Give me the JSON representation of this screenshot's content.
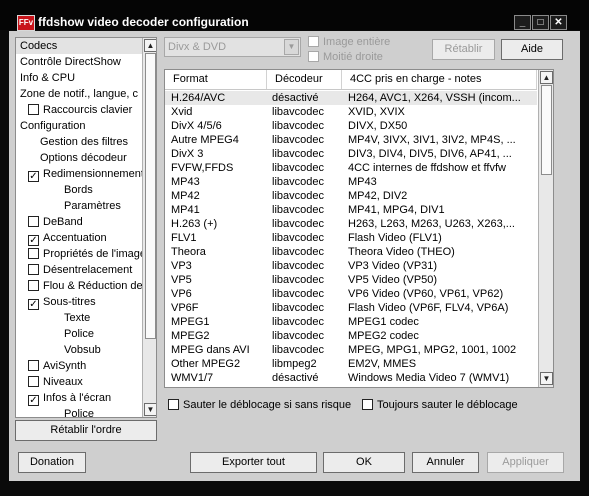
{
  "window": {
    "icon_text": "FFv",
    "title": "ffdshow video decoder configuration",
    "controls": {
      "minimize": "_",
      "maximize": "□",
      "close": "✕"
    }
  },
  "tree": {
    "items": [
      {
        "label": "Codecs",
        "indent": 0,
        "checkbox": false,
        "checked": false,
        "selected": true
      },
      {
        "label": "Contrôle DirectShow",
        "indent": 0,
        "checkbox": false,
        "checked": false,
        "selected": false
      },
      {
        "label": "Info & CPU",
        "indent": 0,
        "checkbox": false,
        "checked": false,
        "selected": false
      },
      {
        "label": "Zone de notif., langue, c",
        "indent": 0,
        "checkbox": false,
        "checked": false,
        "selected": false
      },
      {
        "label": "Raccourcis clavier",
        "indent": 1,
        "checkbox": true,
        "checked": false,
        "selected": false
      },
      {
        "label": "Configuration",
        "indent": 0,
        "checkbox": false,
        "checked": false,
        "selected": false
      },
      {
        "label": "Gestion des filtres",
        "indent": 2,
        "checkbox": false,
        "checked": false,
        "selected": false
      },
      {
        "label": "Options décodeur",
        "indent": 2,
        "checkbox": false,
        "checked": false,
        "selected": false
      },
      {
        "label": "Redimensionnement",
        "indent": 1,
        "checkbox": true,
        "checked": true,
        "selected": false
      },
      {
        "label": "Bords",
        "indent": 3,
        "checkbox": false,
        "checked": false,
        "selected": false
      },
      {
        "label": "Paramètres",
        "indent": 3,
        "checkbox": false,
        "checked": false,
        "selected": false
      },
      {
        "label": "DeBand",
        "indent": 1,
        "checkbox": true,
        "checked": false,
        "selected": false
      },
      {
        "label": "Accentuation",
        "indent": 1,
        "checkbox": true,
        "checked": true,
        "selected": false
      },
      {
        "label": "Propriétés de l'image",
        "indent": 1,
        "checkbox": true,
        "checked": false,
        "selected": false
      },
      {
        "label": "Désentrelacement",
        "indent": 1,
        "checkbox": true,
        "checked": false,
        "selected": false
      },
      {
        "label": "Flou & Réduction de",
        "indent": 1,
        "checkbox": true,
        "checked": false,
        "selected": false
      },
      {
        "label": "Sous-titres",
        "indent": 1,
        "checkbox": true,
        "checked": true,
        "selected": false
      },
      {
        "label": "Texte",
        "indent": 3,
        "checkbox": false,
        "checked": false,
        "selected": false
      },
      {
        "label": "Police",
        "indent": 3,
        "checkbox": false,
        "checked": false,
        "selected": false
      },
      {
        "label": "Vobsub",
        "indent": 3,
        "checkbox": false,
        "checked": false,
        "selected": false
      },
      {
        "label": "AviSynth",
        "indent": 1,
        "checkbox": true,
        "checked": false,
        "selected": false
      },
      {
        "label": "Niveaux",
        "indent": 1,
        "checkbox": true,
        "checked": false,
        "selected": false
      },
      {
        "label": "Infos à l'écran",
        "indent": 1,
        "checkbox": true,
        "checked": true,
        "selected": false
      },
      {
        "label": "Police",
        "indent": 3,
        "checkbox": false,
        "checked": false,
        "selected": false
      }
    ]
  },
  "top": {
    "preset_combo": "Divx & DVD",
    "image_entiere": "Image entière",
    "moitie_droite": "Moitié droite",
    "retablir": "Rétablir",
    "aide": "Aide"
  },
  "codec_table": {
    "headers": [
      "Format",
      "Décodeur",
      "4CC pris en charge - notes"
    ],
    "rows": [
      [
        "H.264/AVC",
        "désactivé",
        "H264, AVC1, X264, VSSH (incom..."
      ],
      [
        "Xvid",
        "libavcodec",
        "XVID, XVIX"
      ],
      [
        "DivX 4/5/6",
        "libavcodec",
        "DIVX, DX50"
      ],
      [
        "Autre MPEG4",
        "libavcodec",
        "MP4V, 3IVX, 3IV1, 3IV2, MP4S, ..."
      ],
      [
        "DivX 3",
        "libavcodec",
        "DIV3, DIV4, DIV5, DIV6, AP41, ..."
      ],
      [
        "FVFW,FFDS",
        "libavcodec",
        "4CC internes de ffdshow et ffvfw"
      ],
      [
        "MP43",
        "libavcodec",
        "MP43"
      ],
      [
        "MP42",
        "libavcodec",
        "MP42, DIV2"
      ],
      [
        "MP41",
        "libavcodec",
        "MP41, MPG4, DIV1"
      ],
      [
        "H.263 (+)",
        "libavcodec",
        "H263, L263, M263, U263, X263,..."
      ],
      [
        "FLV1",
        "libavcodec",
        "Flash Video (FLV1)"
      ],
      [
        "Theora",
        "libavcodec",
        "Theora Video (THEO)"
      ],
      [
        "VP3",
        "libavcodec",
        "VP3 Video (VP31)"
      ],
      [
        "VP5",
        "libavcodec",
        "VP5 Video (VP50)"
      ],
      [
        "VP6",
        "libavcodec",
        "VP6 Video (VP60, VP61, VP62)"
      ],
      [
        "VP6F",
        "libavcodec",
        "Flash Video (VP6F, FLV4, VP6A)"
      ],
      [
        "MPEG1",
        "libavcodec",
        "MPEG1 codec"
      ],
      [
        "MPEG2",
        "libavcodec",
        "MPEG2 codec"
      ],
      [
        "MPEG dans AVI",
        "libavcodec",
        "MPEG, MPG1, MPG2, 1001, 1002"
      ],
      [
        "Other MPEG2",
        "libmpeg2",
        "EM2V, MMES"
      ],
      [
        "WMV1/7",
        "désactivé",
        "Windows Media Video 7 (WMV1)"
      ]
    ],
    "selected_row": 0
  },
  "options": {
    "skip_deblock_safe": "Sauter le déblocage si sans risque",
    "always_skip_deblock": "Toujours sauter le déblocage"
  },
  "buttons": {
    "retablir_ordre": "Rétablir l'ordre",
    "donation": "Donation",
    "exporter_tout": "Exporter tout",
    "ok": "OK",
    "annuler": "Annuler",
    "appliquer": "Appliquer"
  },
  "scroll_arrows": {
    "up": "▲",
    "down": "▼"
  }
}
